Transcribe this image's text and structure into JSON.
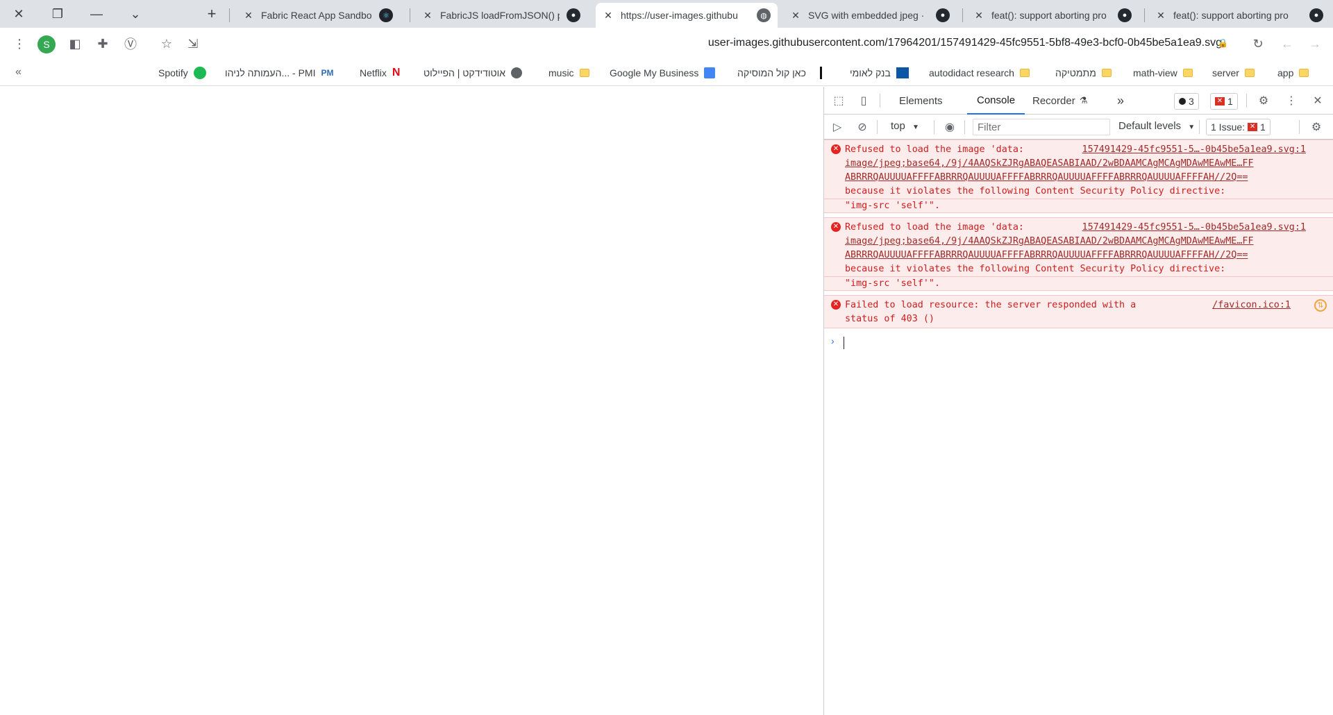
{
  "tabstrip": {
    "tabs": [
      {
        "title": "Fabric React App Sandbox",
        "icon": "react-icon"
      },
      {
        "title": "FabricJS loadFromJSON() p",
        "icon": "github-icon"
      },
      {
        "title": "https://user-images.githubu",
        "icon": "globe-icon",
        "active": true
      },
      {
        "title": "SVG with embedded jpeg ·",
        "icon": "github-icon"
      },
      {
        "title": "feat(): support aborting pro",
        "icon": "github-icon"
      },
      {
        "title": "feat(): support aborting pro",
        "icon": "github-icon"
      }
    ],
    "new_tab_label": "+"
  },
  "toolbar": {
    "profile_initial": "S",
    "url": "user-images.githubusercontent.com/17964201/157491429-45fc9551-5bf8-49e3-bcf0-0b45be5a1ea9.svg"
  },
  "bookmarks": {
    "more": "«",
    "items": [
      {
        "label": "app",
        "icon": "folder-icon"
      },
      {
        "label": "server",
        "icon": "folder-icon"
      },
      {
        "label": "math-view",
        "icon": "folder-icon"
      },
      {
        "label": "מתמטיקה",
        "icon": "folder-icon"
      },
      {
        "label": "autodidact research",
        "icon": "folder-icon"
      },
      {
        "label": "בנק לאומי",
        "icon": "bank-icon"
      },
      {
        "label": "כאן קול המוסיקה",
        "icon": "kan-icon"
      },
      {
        "label": "Google My Business",
        "icon": "gmb-icon"
      },
      {
        "label": "music",
        "icon": "folder-icon"
      },
      {
        "label": "אוטודידקט | הפיילוט",
        "icon": "globe-icon"
      },
      {
        "label": "Netflix",
        "icon": "netflix-icon"
      },
      {
        "label": "העמותה לניהו... - PMI",
        "icon": "pmi-icon"
      },
      {
        "label": "Spotify",
        "icon": "spotify-icon"
      }
    ]
  },
  "devtools": {
    "tabs": {
      "elements": "Elements",
      "console": "Console",
      "recorder": "Recorder"
    },
    "more_tabs": "»",
    "messages_count": "3",
    "errors_count": "1",
    "context": "top",
    "filter_placeholder": "Filter",
    "levels": "Default levels",
    "issues_label": "1 Issue:",
    "issues_count": "1",
    "console_messages": [
      {
        "lines": [
          "Refused to load the image 'data:",
          "image/jpeg;base64,/9j/4AAQSkZJRgABAQEASABIAAD/2wBDAAMCAgMCAgMDAwMEAwME…FF",
          "ABRRRQAUUUUAFFFFABRRRQAUUUUAFFFFABRRRQAUUUUAFFFFABRRRQAUUUUAFFFFAH//2Q==",
          "because it violates the following Content Security Policy directive:",
          "\"img-src 'self'\"."
        ],
        "source": "157491429-45fc9551-5…-0b45be5a1ea9.svg:1"
      },
      {
        "lines": [
          "Refused to load the image 'data:",
          "image/jpeg;base64,/9j/4AAQSkZJRgABAQEASABIAAD/2wBDAAMCAgMCAgMDAwMEAwME…FF",
          "ABRRRQAUUUUAFFFFABRRRQAUUUUAFFFFABRRRQAUUUUAFFFFABRRRQAUUUUAFFFFAH//2Q==",
          "because it violates the following Content Security Policy directive:",
          "\"img-src 'self'\"."
        ],
        "source": "157491429-45fc9551-5…-0b45be5a1ea9.svg:1"
      },
      {
        "lines": [
          "Failed to load resource: the server responded with a",
          "status of 403 ()"
        ],
        "source": "/favicon.ico:1"
      }
    ],
    "prompt": "›"
  },
  "colors": {
    "error_red": "#d01c1c",
    "error_bg": "#fcecec",
    "accent_blue": "#1a73e8"
  }
}
